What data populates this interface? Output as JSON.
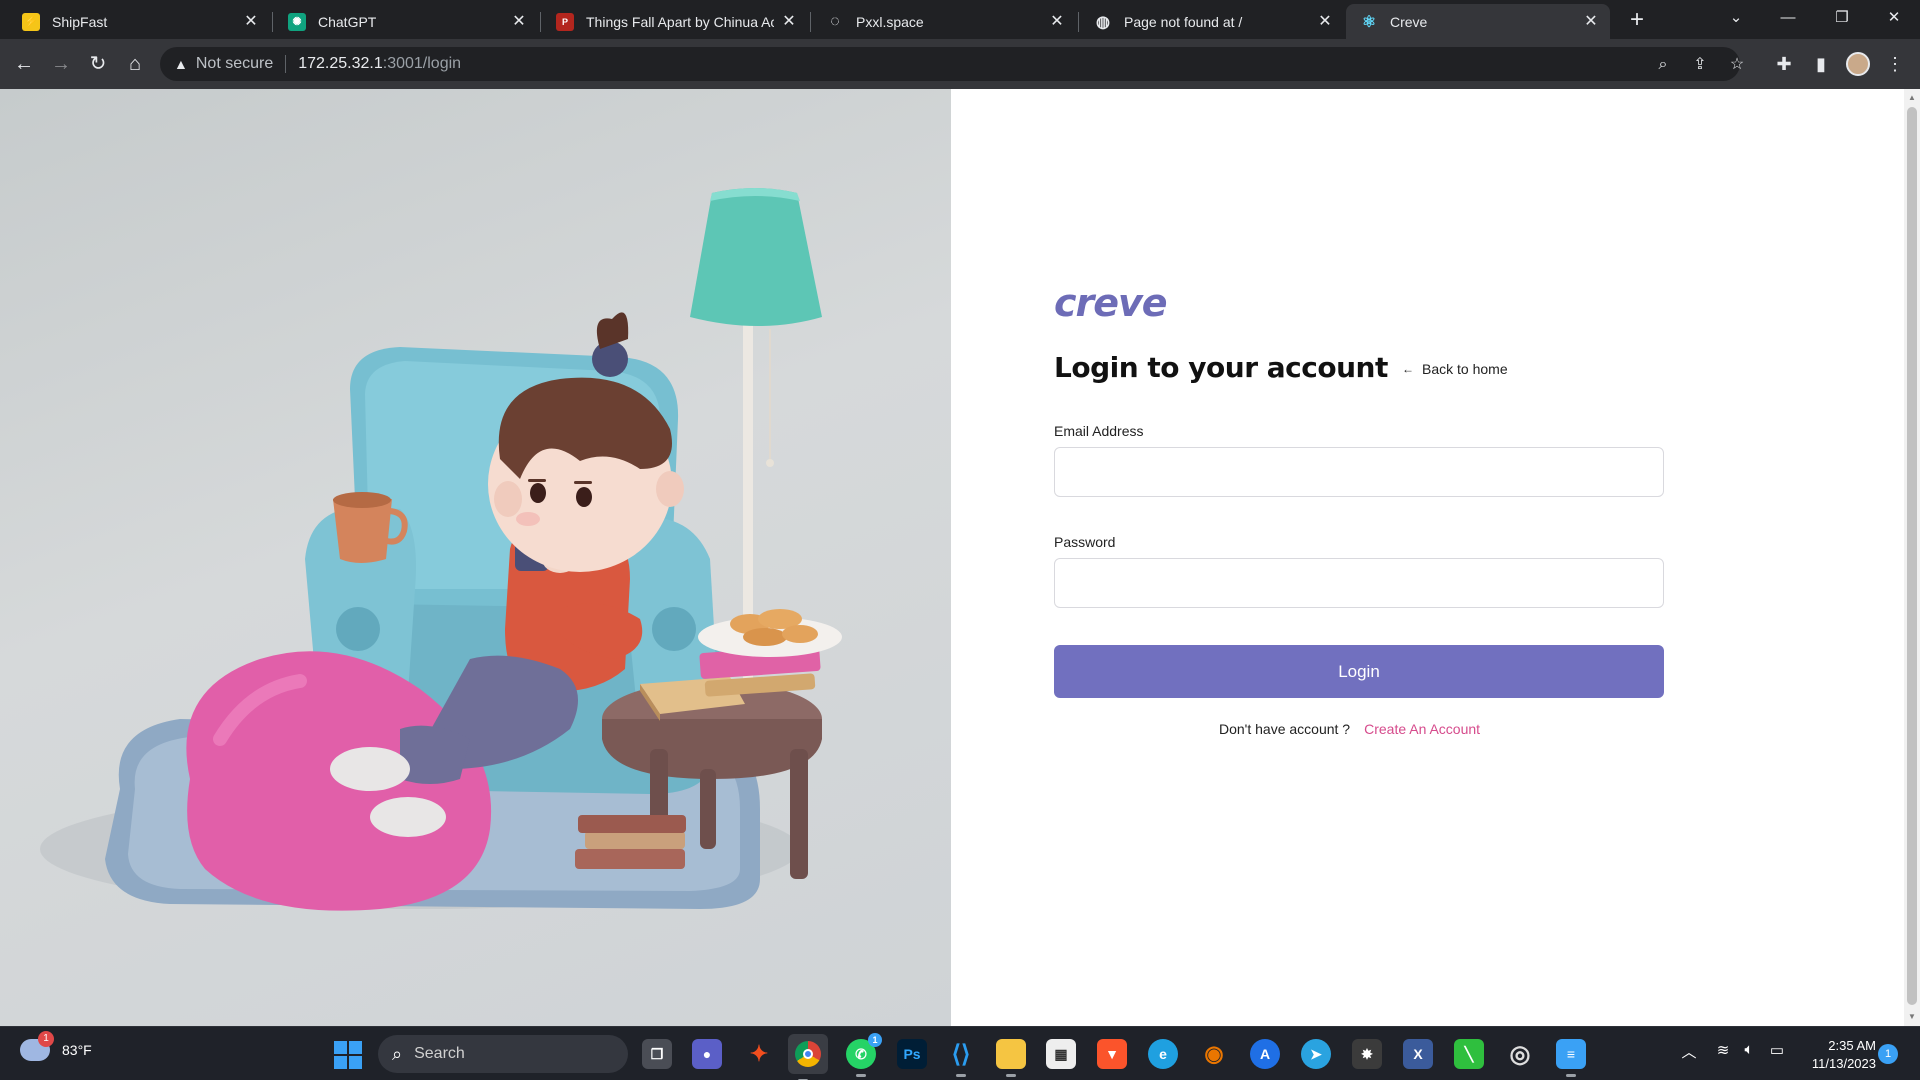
{
  "browser": {
    "tabs": [
      {
        "title": "ShipFast",
        "favicon": "lightning-icon"
      },
      {
        "title": "ChatGPT",
        "favicon": "chatgpt-icon"
      },
      {
        "title": "Things Fall Apart by Chinua Achebe",
        "favicon": "pdf-icon"
      },
      {
        "title": "Pxxl.space",
        "favicon": "pxxl-icon"
      },
      {
        "title": "Page not found at /",
        "favicon": "globe-icon"
      },
      {
        "title": "Creve",
        "favicon": "react-icon"
      }
    ],
    "active_tab": 5,
    "address": {
      "security_label": "Not secure",
      "host": "172.25.32.1",
      "path": ":3001/login"
    }
  },
  "page": {
    "brand": "creve",
    "heading": "Login to your account",
    "back_link": "Back to home",
    "email_label": "Email Address",
    "email_value": "",
    "password_label": "Password",
    "password_value": "",
    "login_button": "Login",
    "signup_prompt": "Don't have account ?",
    "signup_link": "Create An Account",
    "colors": {
      "brand": "#6d6cb7",
      "button": "#7170bf",
      "link": "#d64b8c"
    }
  },
  "taskbar": {
    "weather": {
      "temp": "83°F",
      "badge": "1"
    },
    "search_placeholder": "Search",
    "whatsapp_badge": "1",
    "ps_label": "Ps",
    "time": "2:35 AM",
    "date": "11/13/2023",
    "notification_count": "1"
  }
}
